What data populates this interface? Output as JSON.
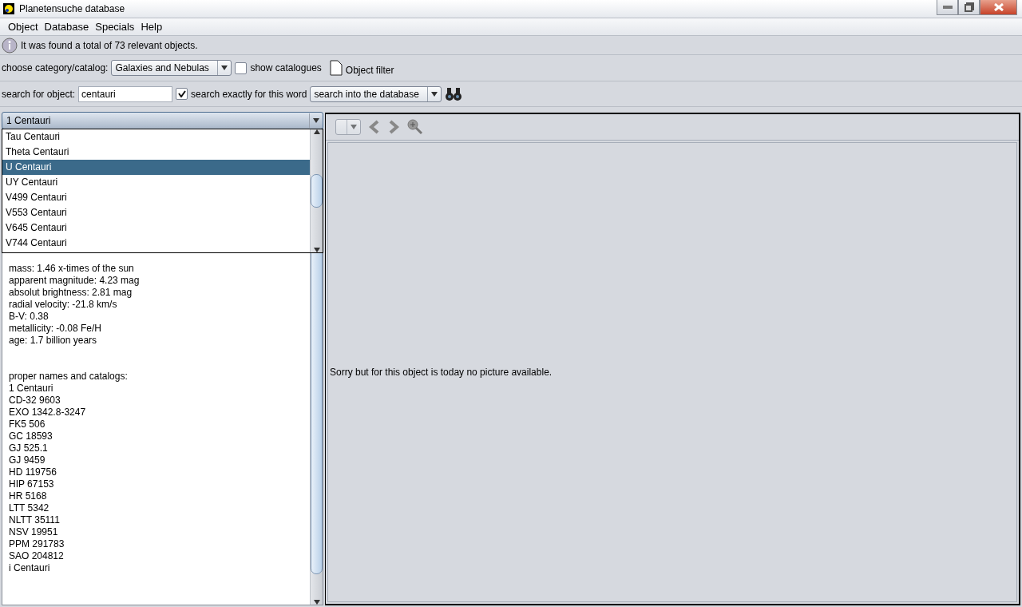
{
  "window": {
    "title": "Planetensuche database"
  },
  "menu": [
    "Object",
    "Database",
    "Specials",
    "Help"
  ],
  "info": {
    "message": "It was found a total of 73 relevant objects."
  },
  "category": {
    "label": "choose category/catalog:",
    "value": "Galaxies and Nebulas",
    "show_catalogues": {
      "label": "show catalogues",
      "checked": false
    },
    "filter_label": "Object filter"
  },
  "search": {
    "label": "search for object:",
    "value": "centauri",
    "exact": {
      "label": "search exactly for this word",
      "checked": true
    },
    "scope": "search into the database"
  },
  "object_combo": {
    "value": "1 Centauri",
    "options": [
      {
        "label": "Tau Centauri",
        "selected": false
      },
      {
        "label": "Theta Centauri",
        "selected": false
      },
      {
        "label": "U Centauri",
        "selected": true
      },
      {
        "label": "UY Centauri",
        "selected": false
      },
      {
        "label": "V499 Centauri",
        "selected": false
      },
      {
        "label": "V553 Centauri",
        "selected": false
      },
      {
        "label": "V645 Centauri",
        "selected": false
      },
      {
        "label": "V744 Centauri",
        "selected": false
      }
    ]
  },
  "properties": [
    "mass: 1.46 x-times of the sun",
    "apparent magnitude: 4.23 mag",
    "absolut brightness: 2.81 mag",
    "radial velocity: -21.8 km/s",
    "B-V: 0.38",
    "metallicity: -0.08 Fe/H",
    "age: 1.7 billion years"
  ],
  "names": {
    "heading": "proper names and catalogs:",
    "items": [
      "1 Centauri",
      "CD-32 9603",
      "EXO 1342.8-3247",
      "FK5 506",
      "GC 18593",
      "GJ 525.1",
      "GJ 9459",
      "HD 119756",
      "HIP 67153",
      "HR 5168",
      "LTT 5342",
      "NLTT 35111",
      "NSV 19951",
      "PPM 291783",
      "SAO 204812",
      "i Centauri"
    ]
  },
  "picture": {
    "message": "Sorry but for this object is today no picture available."
  }
}
